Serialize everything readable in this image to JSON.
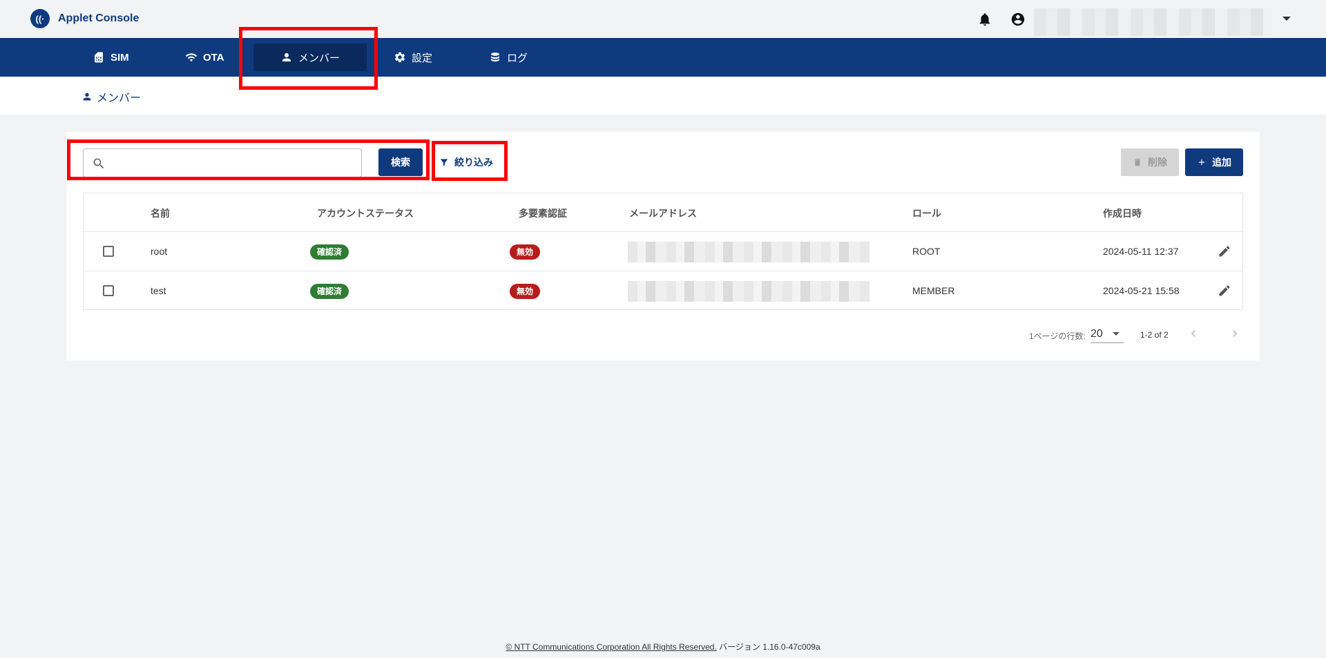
{
  "app": {
    "title": "Applet Console"
  },
  "nav": {
    "items": [
      {
        "label": "SIM",
        "icon": "sim-icon"
      },
      {
        "label": "OTA",
        "icon": "wifi-icon"
      },
      {
        "label": "メンバー",
        "icon": "person-icon",
        "active": true
      },
      {
        "label": "設定",
        "icon": "gear-icon"
      },
      {
        "label": "ログ",
        "icon": "database-icon"
      }
    ]
  },
  "breadcrumb": {
    "label": "メンバー"
  },
  "toolbar": {
    "search_placeholder": "",
    "search_label": "検索",
    "filter_label": "絞り込み",
    "delete_label": "削除",
    "add_label": "追加"
  },
  "table": {
    "headers": [
      "名前",
      "アカウントステータス",
      "多要素認証",
      "メールアドレス",
      "ロール",
      "作成日時"
    ],
    "rows": [
      {
        "name": "root",
        "status": "確認済",
        "mfa": "無効",
        "role": "ROOT",
        "created": "2024-05-11 12:37"
      },
      {
        "name": "test",
        "status": "確認済",
        "mfa": "無効",
        "role": "MEMBER",
        "created": "2024-05-21 15:58"
      }
    ]
  },
  "pagination": {
    "rows_label": "1ページの行数:",
    "rows_per_page": "20",
    "range": "1-2 of 2"
  },
  "footer": {
    "copyright": "© NTT Communications Corporation All Rights Reserved.",
    "version": "バージョン 1.16.0-47c009a"
  },
  "colors": {
    "brand": "#0f3a7e",
    "confirmed": "#2e7d32",
    "disabled": "#b71c1c",
    "annotation": "#ff0000"
  }
}
